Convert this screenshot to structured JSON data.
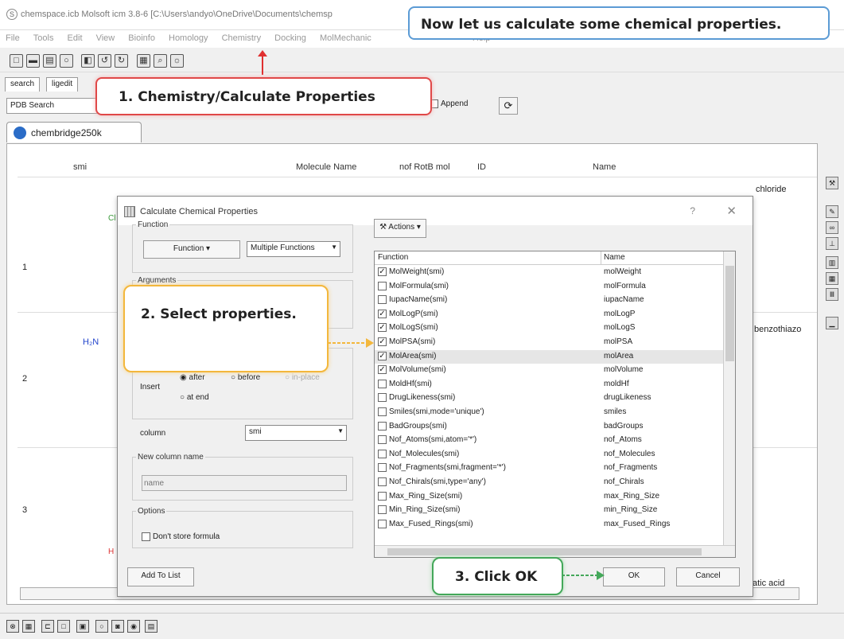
{
  "window": {
    "title": "chemspace.icb Molsoft icm 3.8-6  [C:\\Users\\andyo\\OneDrive\\Documents\\chemsp"
  },
  "menu": [
    "File",
    "Tools",
    "Edit",
    "View",
    "Bioinfo",
    "Homology",
    "Chemistry",
    "Docking",
    "MolMechanic",
    "Help"
  ],
  "tabs": [
    "search",
    "ligedit"
  ],
  "search": {
    "source": "PDB Search",
    "append_label": "Append"
  },
  "doc_tab": "chembridge250k",
  "table": {
    "headers": [
      "smi",
      "Molecule Name",
      "nof RotB mol",
      "ID",
      "Name"
    ],
    "rows": [
      "1",
      "2",
      "3"
    ],
    "visible_fragments": [
      "chloride",
      "benzothiazo",
      "atic acid"
    ],
    "structure_labels": [
      "H₂N",
      "Cl",
      "H"
    ]
  },
  "dialog": {
    "title": "Calculate Chemical Properties",
    "help": "?",
    "close": "✕",
    "function_group": "Function",
    "function_button": "Function",
    "function_combo": "Multiple Functions",
    "arguments_group": "Arguments",
    "insert_label": "Insert",
    "insert_after": "after",
    "insert_before": "before",
    "insert_inplace": "in-place",
    "insert_atend": "at end",
    "column_label": "column",
    "column_value": "smi",
    "newcol_group": "New column name",
    "newcol_placeholder": "name",
    "options_group": "Options",
    "dont_store": "Don't store formula",
    "actions": "Actions",
    "list_headers": {
      "function": "Function",
      "name": "Name"
    },
    "functions": [
      {
        "fn": "MolWeight(smi)",
        "name": "molWeight",
        "checked": true
      },
      {
        "fn": "MolFormula(smi)",
        "name": "molFormula",
        "checked": false
      },
      {
        "fn": "IupacName(smi)",
        "name": "iupacName",
        "checked": false
      },
      {
        "fn": "MolLogP(smi)",
        "name": "molLogP",
        "checked": true
      },
      {
        "fn": "MolLogS(smi)",
        "name": "molLogS",
        "checked": true
      },
      {
        "fn": "MolPSA(smi)",
        "name": "molPSA",
        "checked": true
      },
      {
        "fn": "MolArea(smi)",
        "name": "molArea",
        "checked": true,
        "selected": true
      },
      {
        "fn": "MolVolume(smi)",
        "name": "molVolume",
        "checked": true
      },
      {
        "fn": "MoldHf(smi)",
        "name": "moldHf",
        "checked": false
      },
      {
        "fn": "DrugLikeness(smi)",
        "name": "drugLikeness",
        "checked": false
      },
      {
        "fn": "Smiles(smi,mode='unique')",
        "name": "smiles",
        "checked": false
      },
      {
        "fn": "BadGroups(smi)",
        "name": "badGroups",
        "checked": false
      },
      {
        "fn": "Nof_Atoms(smi,atom='*')",
        "name": "nof_Atoms",
        "checked": false
      },
      {
        "fn": "Nof_Molecules(smi)",
        "name": "nof_Molecules",
        "checked": false
      },
      {
        "fn": "Nof_Fragments(smi,fragment='*')",
        "name": "nof_Fragments",
        "checked": false
      },
      {
        "fn": "Nof_Chirals(smi,type='any')",
        "name": "nof_Chirals",
        "checked": false
      },
      {
        "fn": "Max_Ring_Size(smi)",
        "name": "max_Ring_Size",
        "checked": false
      },
      {
        "fn": "Min_Ring_Size(smi)",
        "name": "min_Ring_Size",
        "checked": false
      },
      {
        "fn": "Max_Fused_Rings(smi)",
        "name": "max_Fused_Rings",
        "checked": false
      }
    ],
    "add_to_list": "Add To List",
    "ok": "OK",
    "cancel": "Cancel"
  },
  "callouts": {
    "top": "Now let us calculate some chemical properties.",
    "step1": "1. Chemistry/Calculate Properties",
    "step2": "2. Select properties.",
    "step3": "3. Click OK"
  },
  "colors": {
    "callout_blue": "#5b9bd5",
    "callout_red": "#e04848",
    "callout_orange": "#f3b73c",
    "callout_green": "#44a85a"
  }
}
